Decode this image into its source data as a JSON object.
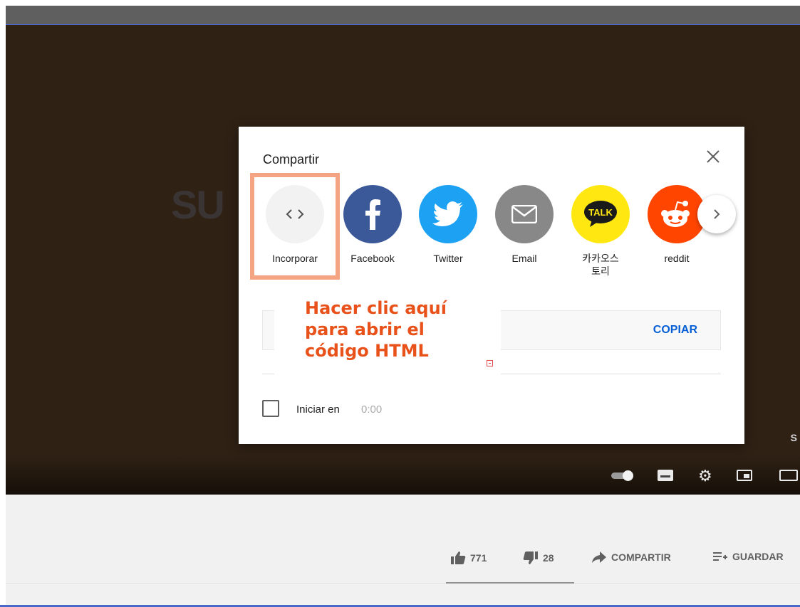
{
  "video": {
    "logo_text": "SU",
    "corner_text": "S"
  },
  "share_dialog": {
    "title": "Compartir",
    "items": [
      {
        "label": "Incorporar",
        "icon": "embed-icon",
        "color": "#f2f2f2"
      },
      {
        "label": "Facebook",
        "icon": "facebook-icon",
        "color": "#3b5998"
      },
      {
        "label": "Twitter",
        "icon": "twitter-icon",
        "color": "#1da1f2"
      },
      {
        "label": "Email",
        "icon": "email-icon",
        "color": "#888888"
      },
      {
        "label": "카카오스토리",
        "icon": "kakao-talk-icon",
        "color": "#ffe812"
      },
      {
        "label": "reddit",
        "icon": "reddit-icon",
        "color": "#ff4500"
      }
    ],
    "copy_label": "COPIAR",
    "start_label": "Iniciar en",
    "start_time": "0:00"
  },
  "annotation": {
    "text": "Hacer clic aquí\npara abrir el\ncódigo HTML",
    "color": "#e8521a"
  },
  "actions": {
    "likes": "771",
    "dislikes": "28",
    "share_label": "COMPARTIR",
    "save_label": "GUARDAR"
  },
  "colors": {
    "highlight_border": "#f4a383",
    "copy_blue": "#065fd4"
  }
}
